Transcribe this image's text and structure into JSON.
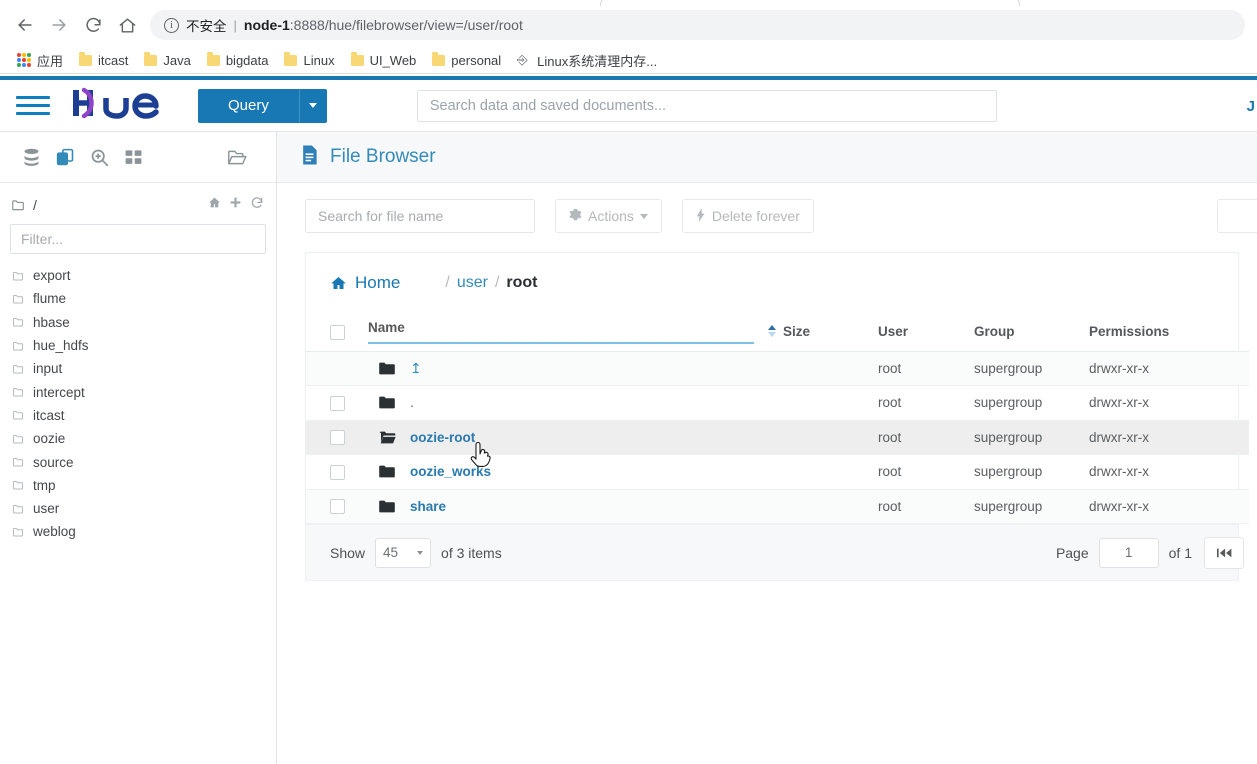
{
  "browser": {
    "back_icon": "back-arrow-icon",
    "forward_icon": "forward-arrow-icon",
    "reload_icon": "reload-icon",
    "home_icon": "home-icon",
    "security_label": "不安全",
    "url_host": "node-1",
    "url_rest": ":8888/hue/filebrowser/view=/user/root",
    "bookmarks": [
      {
        "label": "应用",
        "icon": "apps-grid-icon"
      },
      {
        "label": "itcast",
        "icon": "folder-icon"
      },
      {
        "label": "Java",
        "icon": "folder-icon"
      },
      {
        "label": "bigdata",
        "icon": "folder-icon"
      },
      {
        "label": "Linux",
        "icon": "folder-icon"
      },
      {
        "label": "UI_Web",
        "icon": "folder-icon"
      },
      {
        "label": "personal",
        "icon": "folder-icon"
      },
      {
        "label": "Linux系统清理内存...",
        "icon": "page-icon"
      }
    ]
  },
  "navbar": {
    "logo_text": "hue",
    "query_label": "Query",
    "search_placeholder": "Search data and saved documents...",
    "user_label": "J",
    "accent_color": "#1878b3"
  },
  "sidebar": {
    "icons": [
      {
        "name": "database-icon",
        "active": false
      },
      {
        "name": "documents-icon",
        "active": true
      },
      {
        "name": "search-plus-icon",
        "active": false
      },
      {
        "name": "grid-icon",
        "active": false
      }
    ],
    "right_icon": "open-folder-icon",
    "path_label": "/",
    "path_actions": [
      "home-icon",
      "plus-icon",
      "refresh-icon"
    ],
    "filter_placeholder": "Filter...",
    "items": [
      {
        "label": "export"
      },
      {
        "label": "flume"
      },
      {
        "label": "hbase"
      },
      {
        "label": "hue_hdfs"
      },
      {
        "label": "input"
      },
      {
        "label": "intercept"
      },
      {
        "label": "itcast"
      },
      {
        "label": "oozie"
      },
      {
        "label": "source"
      },
      {
        "label": "tmp"
      },
      {
        "label": "user"
      },
      {
        "label": "weblog"
      }
    ]
  },
  "main": {
    "page_title": "File Browser",
    "toolbar": {
      "search_placeholder": "Search for file name",
      "actions_label": "Actions",
      "delete_label": "Delete forever"
    },
    "breadcrumb": {
      "home_label": "Home",
      "sep": "/",
      "parts": [
        {
          "label": "user",
          "current": false
        },
        {
          "label": "root",
          "current": true
        }
      ]
    },
    "table": {
      "columns": [
        "Name",
        "Size",
        "User",
        "Group",
        "Permissions"
      ],
      "sort_column": "Name",
      "sort_direction": "asc",
      "rows": [
        {
          "icon": "folder-icon",
          "name": "↥",
          "name_style": "up",
          "size": "",
          "user": "root",
          "group": "supergroup",
          "permissions": "drwxr-xr-x",
          "checkbox": false,
          "hover": false
        },
        {
          "icon": "folder-icon",
          "name": ".",
          "name_style": "dot",
          "size": "",
          "user": "root",
          "group": "supergroup",
          "permissions": "drwxr-xr-x",
          "checkbox": true,
          "hover": false
        },
        {
          "icon": "open-folder-icon",
          "name": "oozie-root",
          "name_style": "link",
          "size": "",
          "user": "root",
          "group": "supergroup",
          "permissions": "drwxr-xr-x",
          "checkbox": true,
          "hover": true
        },
        {
          "icon": "folder-icon",
          "name": "oozie_works",
          "name_style": "link",
          "size": "",
          "user": "root",
          "group": "supergroup",
          "permissions": "drwxr-xr-x",
          "checkbox": true,
          "hover": false
        },
        {
          "icon": "folder-icon",
          "name": "share",
          "name_style": "link",
          "size": "",
          "user": "root",
          "group": "supergroup",
          "permissions": "drwxr-xr-x",
          "checkbox": true,
          "hover": false
        }
      ]
    },
    "footer": {
      "show_label": "Show",
      "page_size": "45",
      "items_label": "of 3 items",
      "page_label": "Page",
      "page_number": "1",
      "page_total": "of 1",
      "first_page_icon": "first-page-icon"
    }
  }
}
